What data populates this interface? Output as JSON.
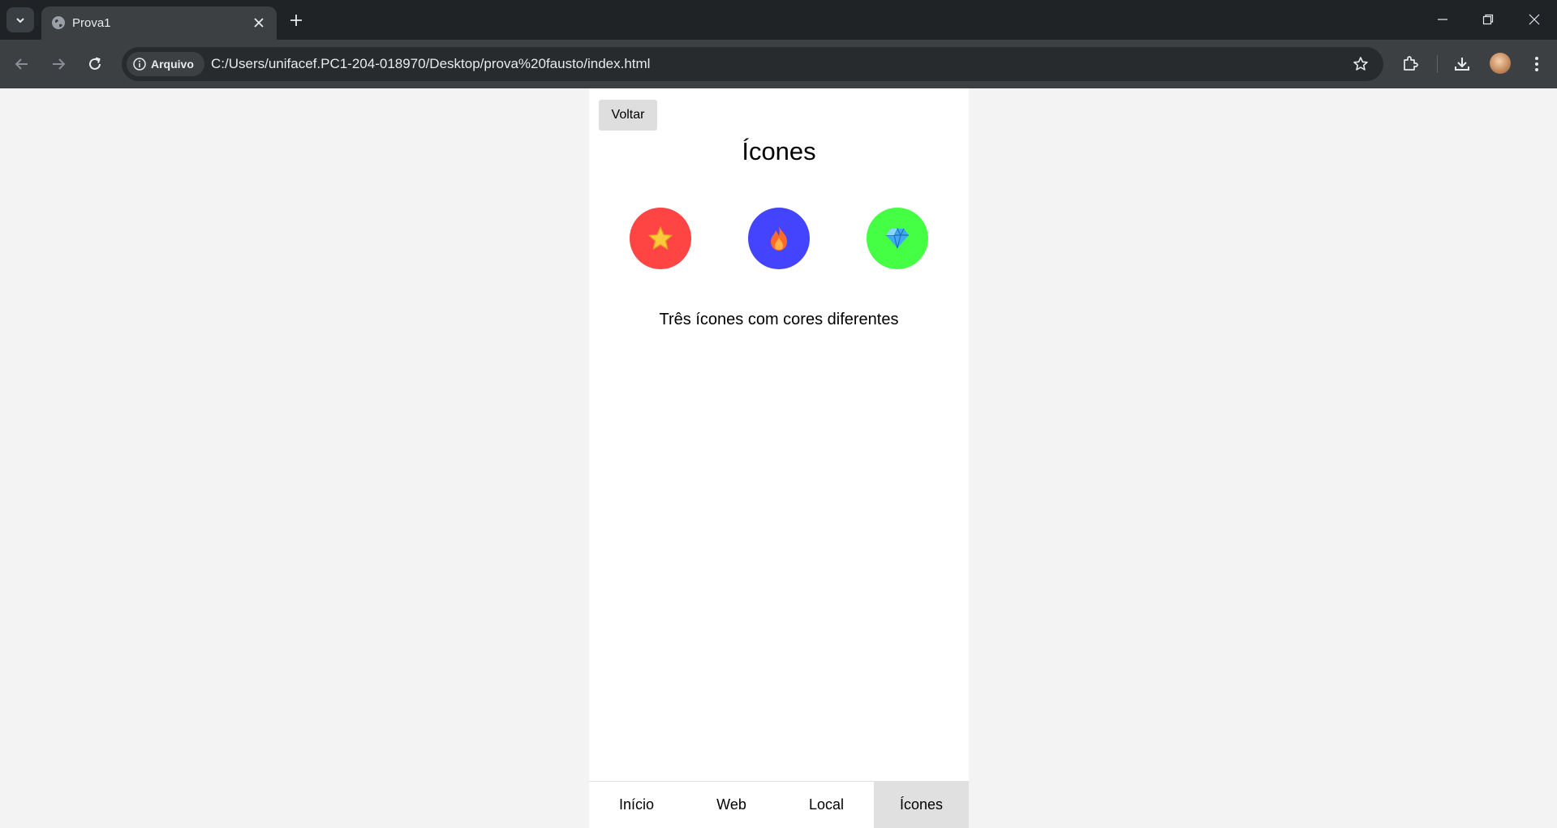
{
  "browser": {
    "tab_title": "Prova1",
    "site_chip_label": "Arquivo",
    "url": "C:/Users/unifacef.PC1-204-018970/Desktop/prova%20fausto/index.html"
  },
  "page": {
    "back_label": "Voltar",
    "title": "Ícones",
    "description": "Três ícones com cores diferentes",
    "icons": [
      {
        "name": "star-icon",
        "color": "#ff4444"
      },
      {
        "name": "fire-icon",
        "color": "#4444ff"
      },
      {
        "name": "diamond-icon",
        "color": "#44ff44"
      }
    ]
  },
  "bottom_nav": {
    "tabs": [
      {
        "label": "Início",
        "active": false
      },
      {
        "label": "Web",
        "active": false
      },
      {
        "label": "Local",
        "active": false
      },
      {
        "label": "Ícones",
        "active": true
      }
    ]
  }
}
